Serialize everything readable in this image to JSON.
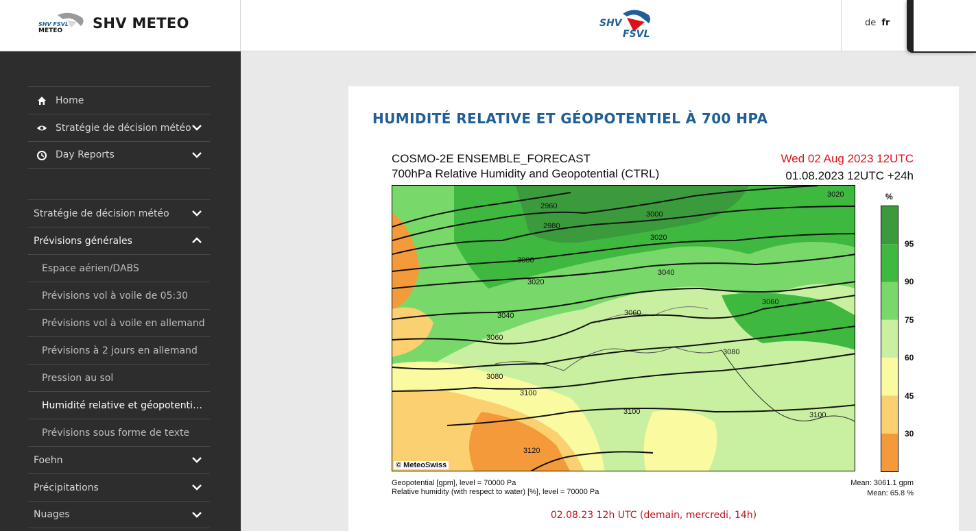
{
  "header": {
    "brand_name": "SHV METEO",
    "brand_logo_text_top": "SHV FSVL",
    "brand_logo_text_bottom": "METEO",
    "center_logo_top": "SHV",
    "center_logo_bottom": "FSVL",
    "lang_de": "de",
    "lang_fr": "fr",
    "colors": {
      "logo_red": "#e0101a",
      "logo_blue": "#1f5e96"
    }
  },
  "sidebar": {
    "top_nav": [
      {
        "label": "Home",
        "icon": "home-icon"
      },
      {
        "label": "Stratégie de décision météo",
        "icon": "eye-icon",
        "chevron": "down"
      },
      {
        "label": "Day Reports",
        "icon": "clock-icon",
        "chevron": "down"
      }
    ],
    "main_nav": [
      {
        "label": "Stratégie de décision météo",
        "chevron": "down"
      },
      {
        "label": "Prévisions générales",
        "chevron": "up"
      },
      {
        "label": "Espace aérien/DABS"
      },
      {
        "label": "Prévisions vol à voile de 05:30"
      },
      {
        "label": "Prévisions vol à voile en allemand"
      },
      {
        "label": "Prévisions à 2 jours en allemand"
      },
      {
        "label": "Pression au sol"
      },
      {
        "label": "Humidité relative et géopotentiel à 700 hPa"
      },
      {
        "label": "Prévisions sous forme de texte"
      },
      {
        "label": "Foehn",
        "chevron": "down"
      },
      {
        "label": "Précipitations",
        "chevron": "down"
      },
      {
        "label": "Nuages",
        "chevron": "down"
      }
    ]
  },
  "main": {
    "title": "HUMIDITÉ RELATIVE ET GÉOPOTENTIEL À 700 HPA",
    "caption": "02.08.23 12h UTC (demain, mercredi, 14h)"
  },
  "chart": {
    "title_line1": "COSMO-2E ENSEMBLE_FORECAST",
    "title_line2": "700hPa Relative Humidity and Geopotential (CTRL)",
    "valid_time": "Wed 02 Aug 2023 12UTC",
    "run_time": "01.08.2023 12UTC +24h",
    "copyright": "© MeteoSwiss",
    "footer_left_1": "Geopotential [gpm], level = 70000 Pa",
    "footer_left_2": "Relative humidity (with respect to water) [%], level = 70000 Pa",
    "footer_right_1": "Mean: 3061.1 gpm",
    "footer_right_2": "Mean:   65.8 %",
    "legend_unit": "%",
    "legend_levels": [
      "95",
      "90",
      "75",
      "60",
      "45",
      "30"
    ],
    "legend_colors": [
      "#3a9a3c",
      "#3fb83f",
      "#78d86a",
      "#c8f0a0",
      "#fafaa0",
      "#fbd070",
      "#f59a3a"
    ],
    "contour_labels": [
      {
        "text": "2960"
      },
      {
        "text": "2980"
      },
      {
        "text": "3000"
      },
      {
        "text": "3000"
      },
      {
        "text": "3020"
      },
      {
        "text": "3020"
      },
      {
        "text": "3020"
      },
      {
        "text": "3040"
      },
      {
        "text": "3040"
      },
      {
        "text": "3060"
      },
      {
        "text": "3060"
      },
      {
        "text": "3060"
      },
      {
        "text": "3080"
      },
      {
        "text": "3080"
      },
      {
        "text": "3100"
      },
      {
        "text": "3100"
      },
      {
        "text": "3100"
      },
      {
        "text": "3120"
      }
    ]
  }
}
